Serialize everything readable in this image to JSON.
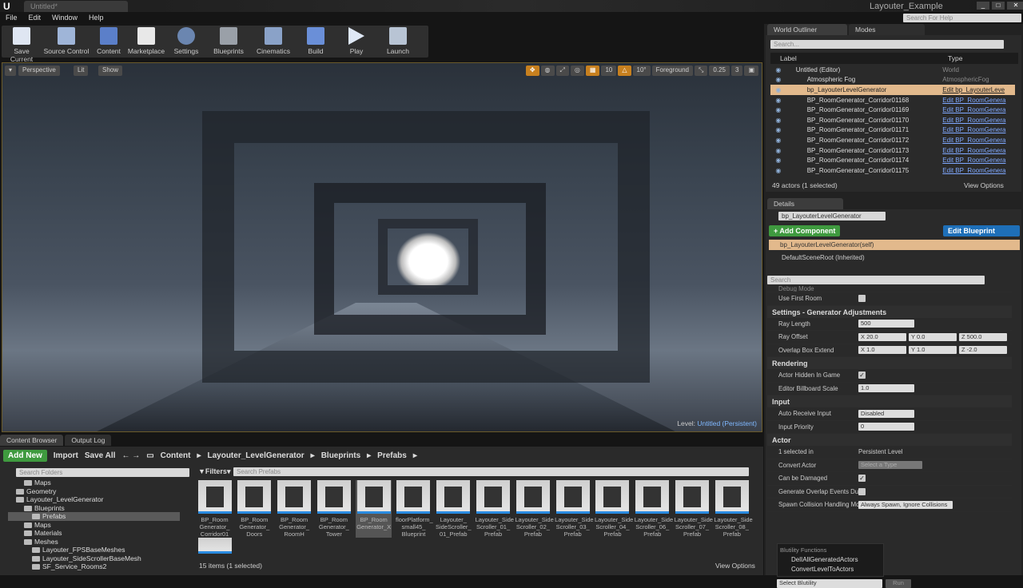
{
  "title_bar": {
    "doc_tab": "Untitled*",
    "project": "Layouter_Example",
    "help_placeholder": "Search For Help",
    "logo": "U"
  },
  "menu": [
    "File",
    "Edit",
    "Window",
    "Help"
  ],
  "toolbar": [
    "Save Current",
    "Source Control",
    "Content",
    "Marketplace",
    "Settings",
    "Blueprints",
    "Cinematics",
    "Build",
    "Play",
    "Launch"
  ],
  "viewport": {
    "perspective": "Perspective",
    "lit": "Lit",
    "show": "Show",
    "grid": "10",
    "angle": "10°",
    "layer": "Foreground",
    "scale": "0.25",
    "camera_speed": "3",
    "level_label": "Level:",
    "level_name": "Untitled (Persistent)"
  },
  "outliner": {
    "tab": "World Outliner",
    "modes_tab": "Modes",
    "search_placeholder": "Search...",
    "col_label": "Label",
    "col_type": "Type",
    "rows": [
      {
        "label": "Untitled (Editor)",
        "type": "World"
      },
      {
        "label": "Atmospheric Fog",
        "type": "AtmosphericFog"
      },
      {
        "label": "bp_LayouterLevelGenerator",
        "type": "Edit bp_LayouterLeve"
      },
      {
        "label": "BP_RoomGenerator_Corridor01168",
        "type": "Edit BP_RoomGenera"
      },
      {
        "label": "BP_RoomGenerator_Corridor01169",
        "type": "Edit BP_RoomGenera"
      },
      {
        "label": "BP_RoomGenerator_Corridor01170",
        "type": "Edit BP_RoomGenera"
      },
      {
        "label": "BP_RoomGenerator_Corridor01171",
        "type": "Edit BP_RoomGenera"
      },
      {
        "label": "BP_RoomGenerator_Corridor01172",
        "type": "Edit BP_RoomGenera"
      },
      {
        "label": "BP_RoomGenerator_Corridor01173",
        "type": "Edit BP_RoomGenera"
      },
      {
        "label": "BP_RoomGenerator_Corridor01174",
        "type": "Edit BP_RoomGenera"
      },
      {
        "label": "BP_RoomGenerator_Corridor01175",
        "type": "Edit BP_RoomGenera"
      }
    ],
    "status": "49 actors (1 selected)",
    "view_options": "View Options"
  },
  "details": {
    "tab": "Details",
    "name": "bp_LayouterLevelGenerator",
    "add_component": "+ Add Component",
    "edit_blueprint": "Edit Blueprint",
    "self": "bp_LayouterLevelGenerator(self)",
    "root": "DefaultSceneRoot (Inherited)",
    "search_placeholder": "Search",
    "debug_mode": "Debug Mode",
    "use_first_room": "Use First Room",
    "cat_settings": "Settings - Generator Adjustments",
    "ray_length": "Ray Length",
    "ray_length_v": "500",
    "ray_offset": "Ray Offset",
    "ray_offset_x": "X  20.0",
    "ray_offset_y": "Y  0.0",
    "ray_offset_z": "Z  500.0",
    "overlap": "Overlap Box Extend",
    "overlap_x": "X  1.0",
    "overlap_y": "Y  1.0",
    "overlap_z": "Z  -2.0",
    "cat_rendering": "Rendering",
    "hidden": "Actor Hidden In Game",
    "billboard": "Editor Billboard Scale",
    "billboard_v": "1.0",
    "cat_input": "Input",
    "auto_input": "Auto Receive Input",
    "auto_input_v": "Disabled",
    "priority": "Input Priority",
    "priority_v": "0",
    "cat_actor": "Actor",
    "selected_in": "1 selected in",
    "selected_in_v": "Persistent Level",
    "convert": "Convert Actor",
    "convert_v": "Select a Type",
    "damaged": "Can be Damaged",
    "overlap_events": "Generate Overlap Events Dur",
    "spawn": "Spawn Collision Handling Mc",
    "spawn_v": "Always Spawn, Ignore Collisions",
    "blutility_header": "Blutility Functions",
    "blutility_items": [
      "DelIAllGeneratedActors",
      "ConvertLevelToActors"
    ],
    "select_blutility": "Select Blutility",
    "run": "Run"
  },
  "content_browser": {
    "tab": "Content Browser",
    "output_tab": "Output Log",
    "add_new": "Add New",
    "import": "Import",
    "save_all": "Save All",
    "path": [
      "Content",
      "Layouter_LevelGenerator",
      "Blueprints",
      "Prefabs"
    ],
    "search_folders": "Search Folders",
    "filters": "Filters",
    "search_assets": "Search Prefabs",
    "folders": [
      {
        "name": "Maps",
        "d": 2
      },
      {
        "name": "Geometry",
        "d": 1
      },
      {
        "name": "Layouter_LevelGenerator",
        "d": 1
      },
      {
        "name": "Blueprints",
        "d": 2
      },
      {
        "name": "Prefabs",
        "d": 3
      },
      {
        "name": "Maps",
        "d": 2
      },
      {
        "name": "Materials",
        "d": 2
      },
      {
        "name": "Meshes",
        "d": 2
      },
      {
        "name": "Layouter_FPSBaseMeshes",
        "d": 3
      },
      {
        "name": "Layouter_SideScrollerBaseMesh",
        "d": 3
      },
      {
        "name": "SF_Service_Rooms2",
        "d": 3
      }
    ],
    "assets": [
      "BP_Room Generator_ Corridor01",
      "BP_Room Generator_ Doors",
      "BP_Room Generator_ RoomH",
      "BP_Room Generator_ Tower",
      "BP_Room Generator_X",
      "floorPlatform_ small45_ Blueprint",
      "Layouter_ SideScroller_ 01_Prefab",
      "Layouter_Side Scroller_01_ Prefab",
      "Layouter_Side Scroller_02_ Prefab",
      "Layouter_Side Scroller_03_ Prefab",
      "Layouter_Side Scroller_04_ Prefab",
      "Layouter_Side Scroller_06_ Prefab",
      "Layouter_Side Scroller_07_ Prefab",
      "Layouter_Side Scroller_08_ Prefab"
    ],
    "status": "15 items (1 selected)",
    "view_options": "View Options"
  }
}
